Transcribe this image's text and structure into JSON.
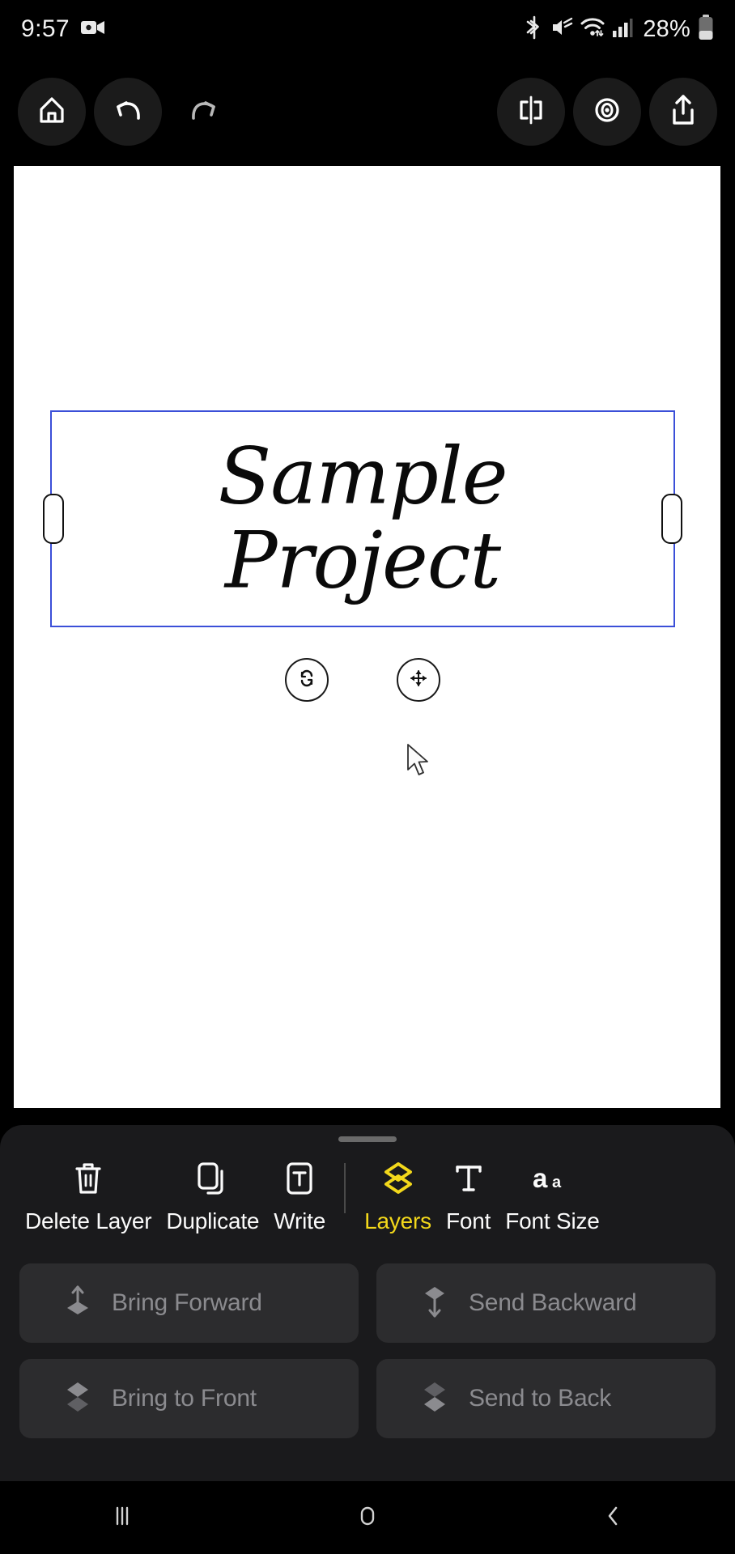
{
  "status_bar": {
    "time": "9:57",
    "recording_icon": "video-camera-icon",
    "icons": [
      "bluetooth-icon",
      "mute-icon",
      "wifi-icon",
      "cellular-signal-icon"
    ],
    "battery_percent": "28%"
  },
  "top_toolbar": {
    "left": [
      {
        "name": "home-button",
        "icon": "home-icon",
        "enabled": true
      },
      {
        "name": "undo-button",
        "icon": "undo-icon",
        "enabled": true
      },
      {
        "name": "redo-button",
        "icon": "redo-icon",
        "enabled": false
      }
    ],
    "right": [
      {
        "name": "flip-button",
        "icon": "flip-horizontal-icon",
        "enabled": true
      },
      {
        "name": "preview-button",
        "icon": "eye-icon",
        "enabled": true
      },
      {
        "name": "share-button",
        "icon": "share-export-icon",
        "enabled": true
      }
    ]
  },
  "canvas": {
    "background_color": "#ffffff",
    "selection": {
      "border_color": "#3b4fd8",
      "handles": [
        "left-resize-handle",
        "right-resize-handle"
      ],
      "rotate_control": "rotate-icon",
      "move_control": "move-icon"
    },
    "text_layer": {
      "content": "Sample\nProject",
      "color": "#0a0a0a"
    },
    "cursor": "mouse-pointer"
  },
  "bottom_sheet": {
    "grabber": "drag-handle",
    "tools": [
      {
        "label": "Delete Layer",
        "icon": "trash-icon",
        "active": false
      },
      {
        "label": "Duplicate",
        "icon": "duplicate-icon",
        "active": false
      },
      {
        "label": "Write",
        "icon": "write-text-icon",
        "active": false
      },
      {
        "label": "Layers",
        "icon": "layers-icon",
        "active": true
      },
      {
        "label": "Font",
        "icon": "font-icon",
        "active": false
      },
      {
        "label": "Font Size",
        "icon": "font-size-icon",
        "active": false
      }
    ],
    "divider_after_index": 2,
    "active_color": "#f3d81b",
    "actions": [
      {
        "label": "Bring Forward",
        "icon": "arrow-up-layer-icon"
      },
      {
        "label": "Send Backward",
        "icon": "arrow-down-layer-icon"
      },
      {
        "label": "Bring to Front",
        "icon": "stack-front-icon"
      },
      {
        "label": "Send to Back",
        "icon": "stack-back-icon"
      }
    ]
  },
  "nav_bar": {
    "recents": "recents-icon",
    "home": "home-circle-icon",
    "back": "back-chevron-icon"
  }
}
